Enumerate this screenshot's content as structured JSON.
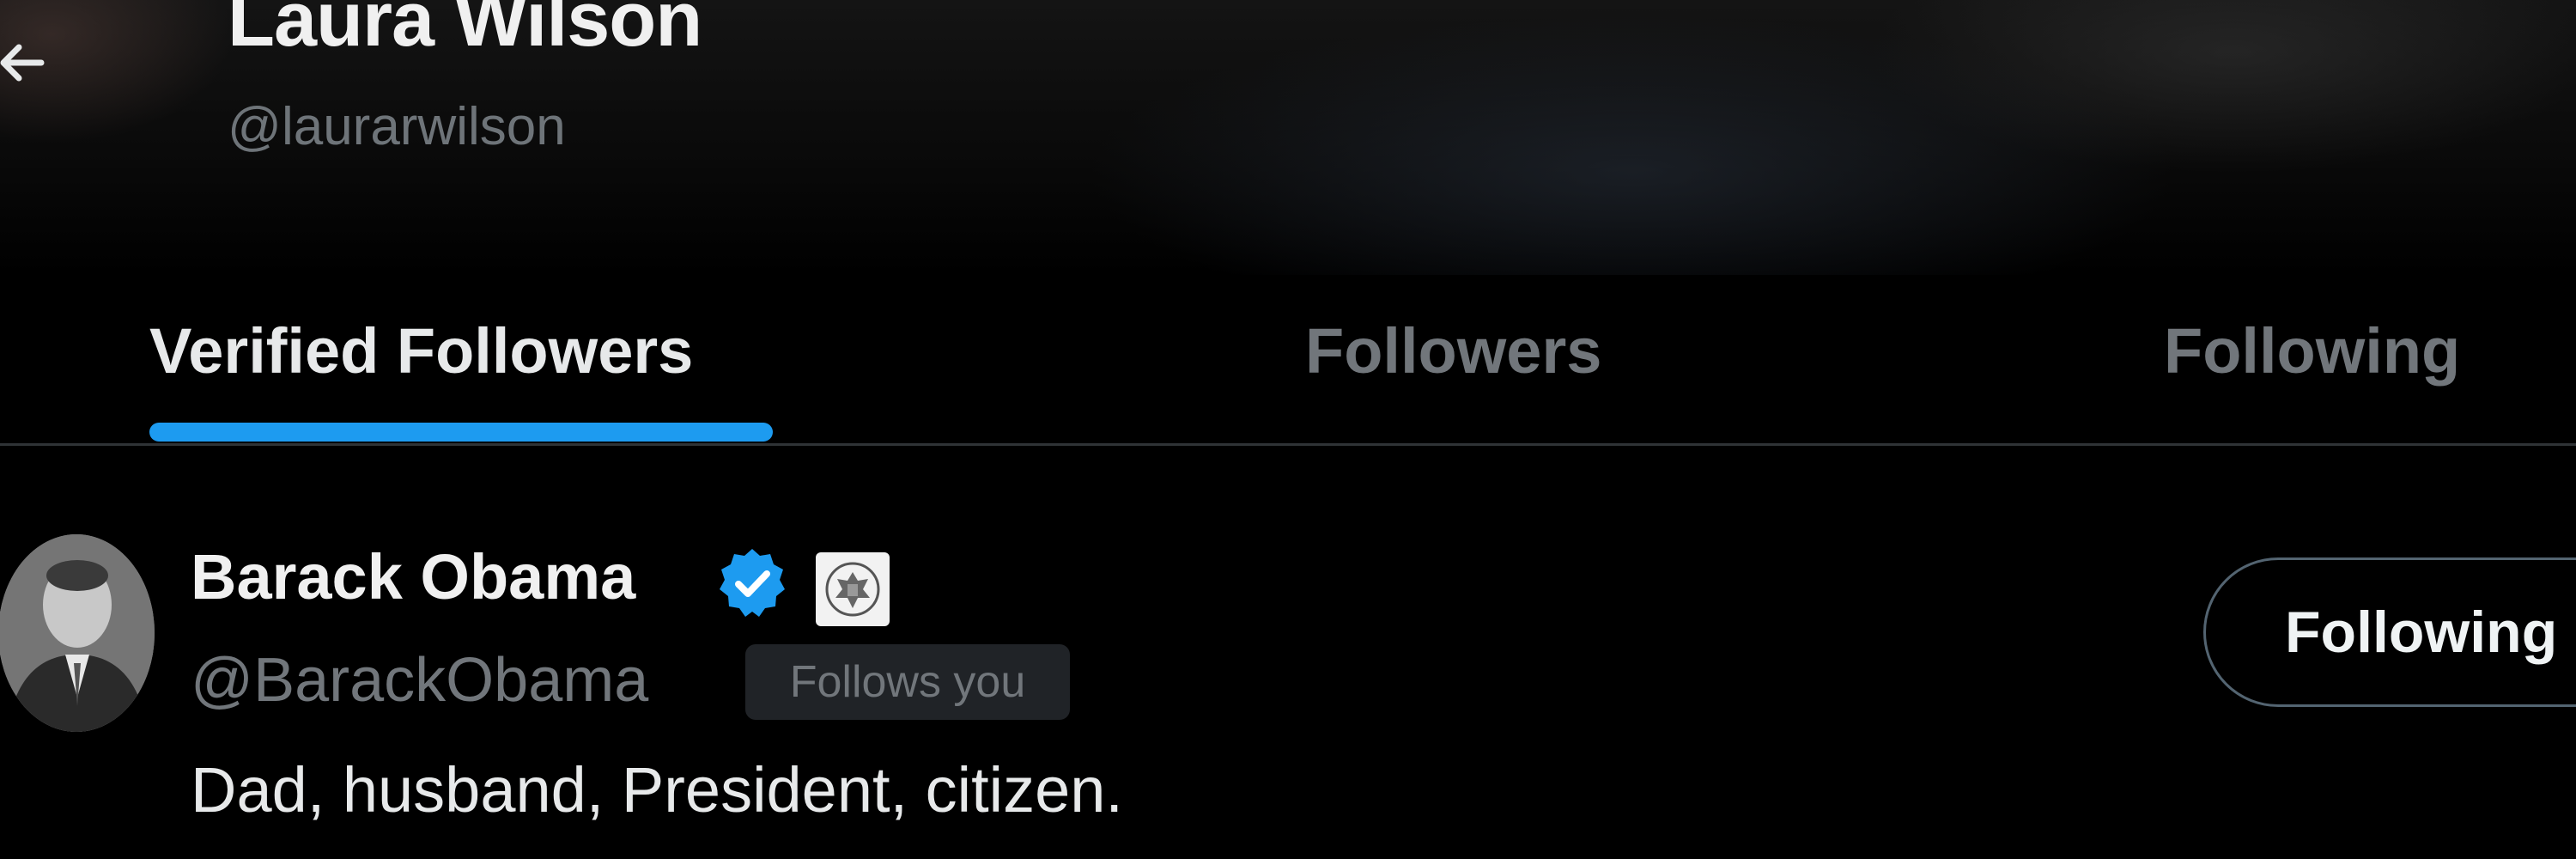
{
  "header": {
    "back_icon": "arrow-left-icon",
    "name": "Laura Wilson",
    "handle": "@laurarwilson"
  },
  "tabs": [
    {
      "label": "Verified Followers",
      "active": true
    },
    {
      "label": "Followers",
      "active": false
    },
    {
      "label": "Following",
      "active": false
    }
  ],
  "accent_color": "#1d9bf0",
  "users": [
    {
      "name": "Barack Obama",
      "verified_icon": "verified-badge-icon",
      "affiliation_icon": "government-seal-icon",
      "handle": "@BarackObama",
      "follows_you": "Follows you",
      "bio": "Dad, husband, President, citizen.",
      "button_label": "Following"
    }
  ]
}
